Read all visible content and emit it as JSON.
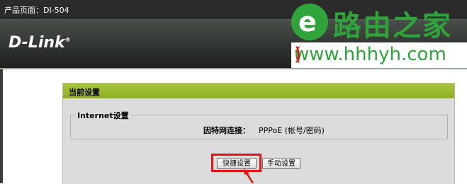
{
  "header": {
    "product_page": "产品页面：DI-504",
    "brand": "D-Link"
  },
  "watermark": {
    "logo_letter": "e",
    "title": "路由之家",
    "url_open": "(",
    "url_text": "www.hhhyh.com",
    "url_close": ")"
  },
  "panel": {
    "title": "当前设置",
    "section_legend": "Internet设置",
    "connection_label": "因特网连接：",
    "connection_value": "PPPoE (帐号/密码)",
    "buttons": {
      "quick_setup": "快捷设置",
      "manual_setup": "手动设置"
    }
  },
  "colors": {
    "accent_green": "#9bb935",
    "watermark_green": "#2ea43b",
    "highlight_red": "#e0121a"
  }
}
